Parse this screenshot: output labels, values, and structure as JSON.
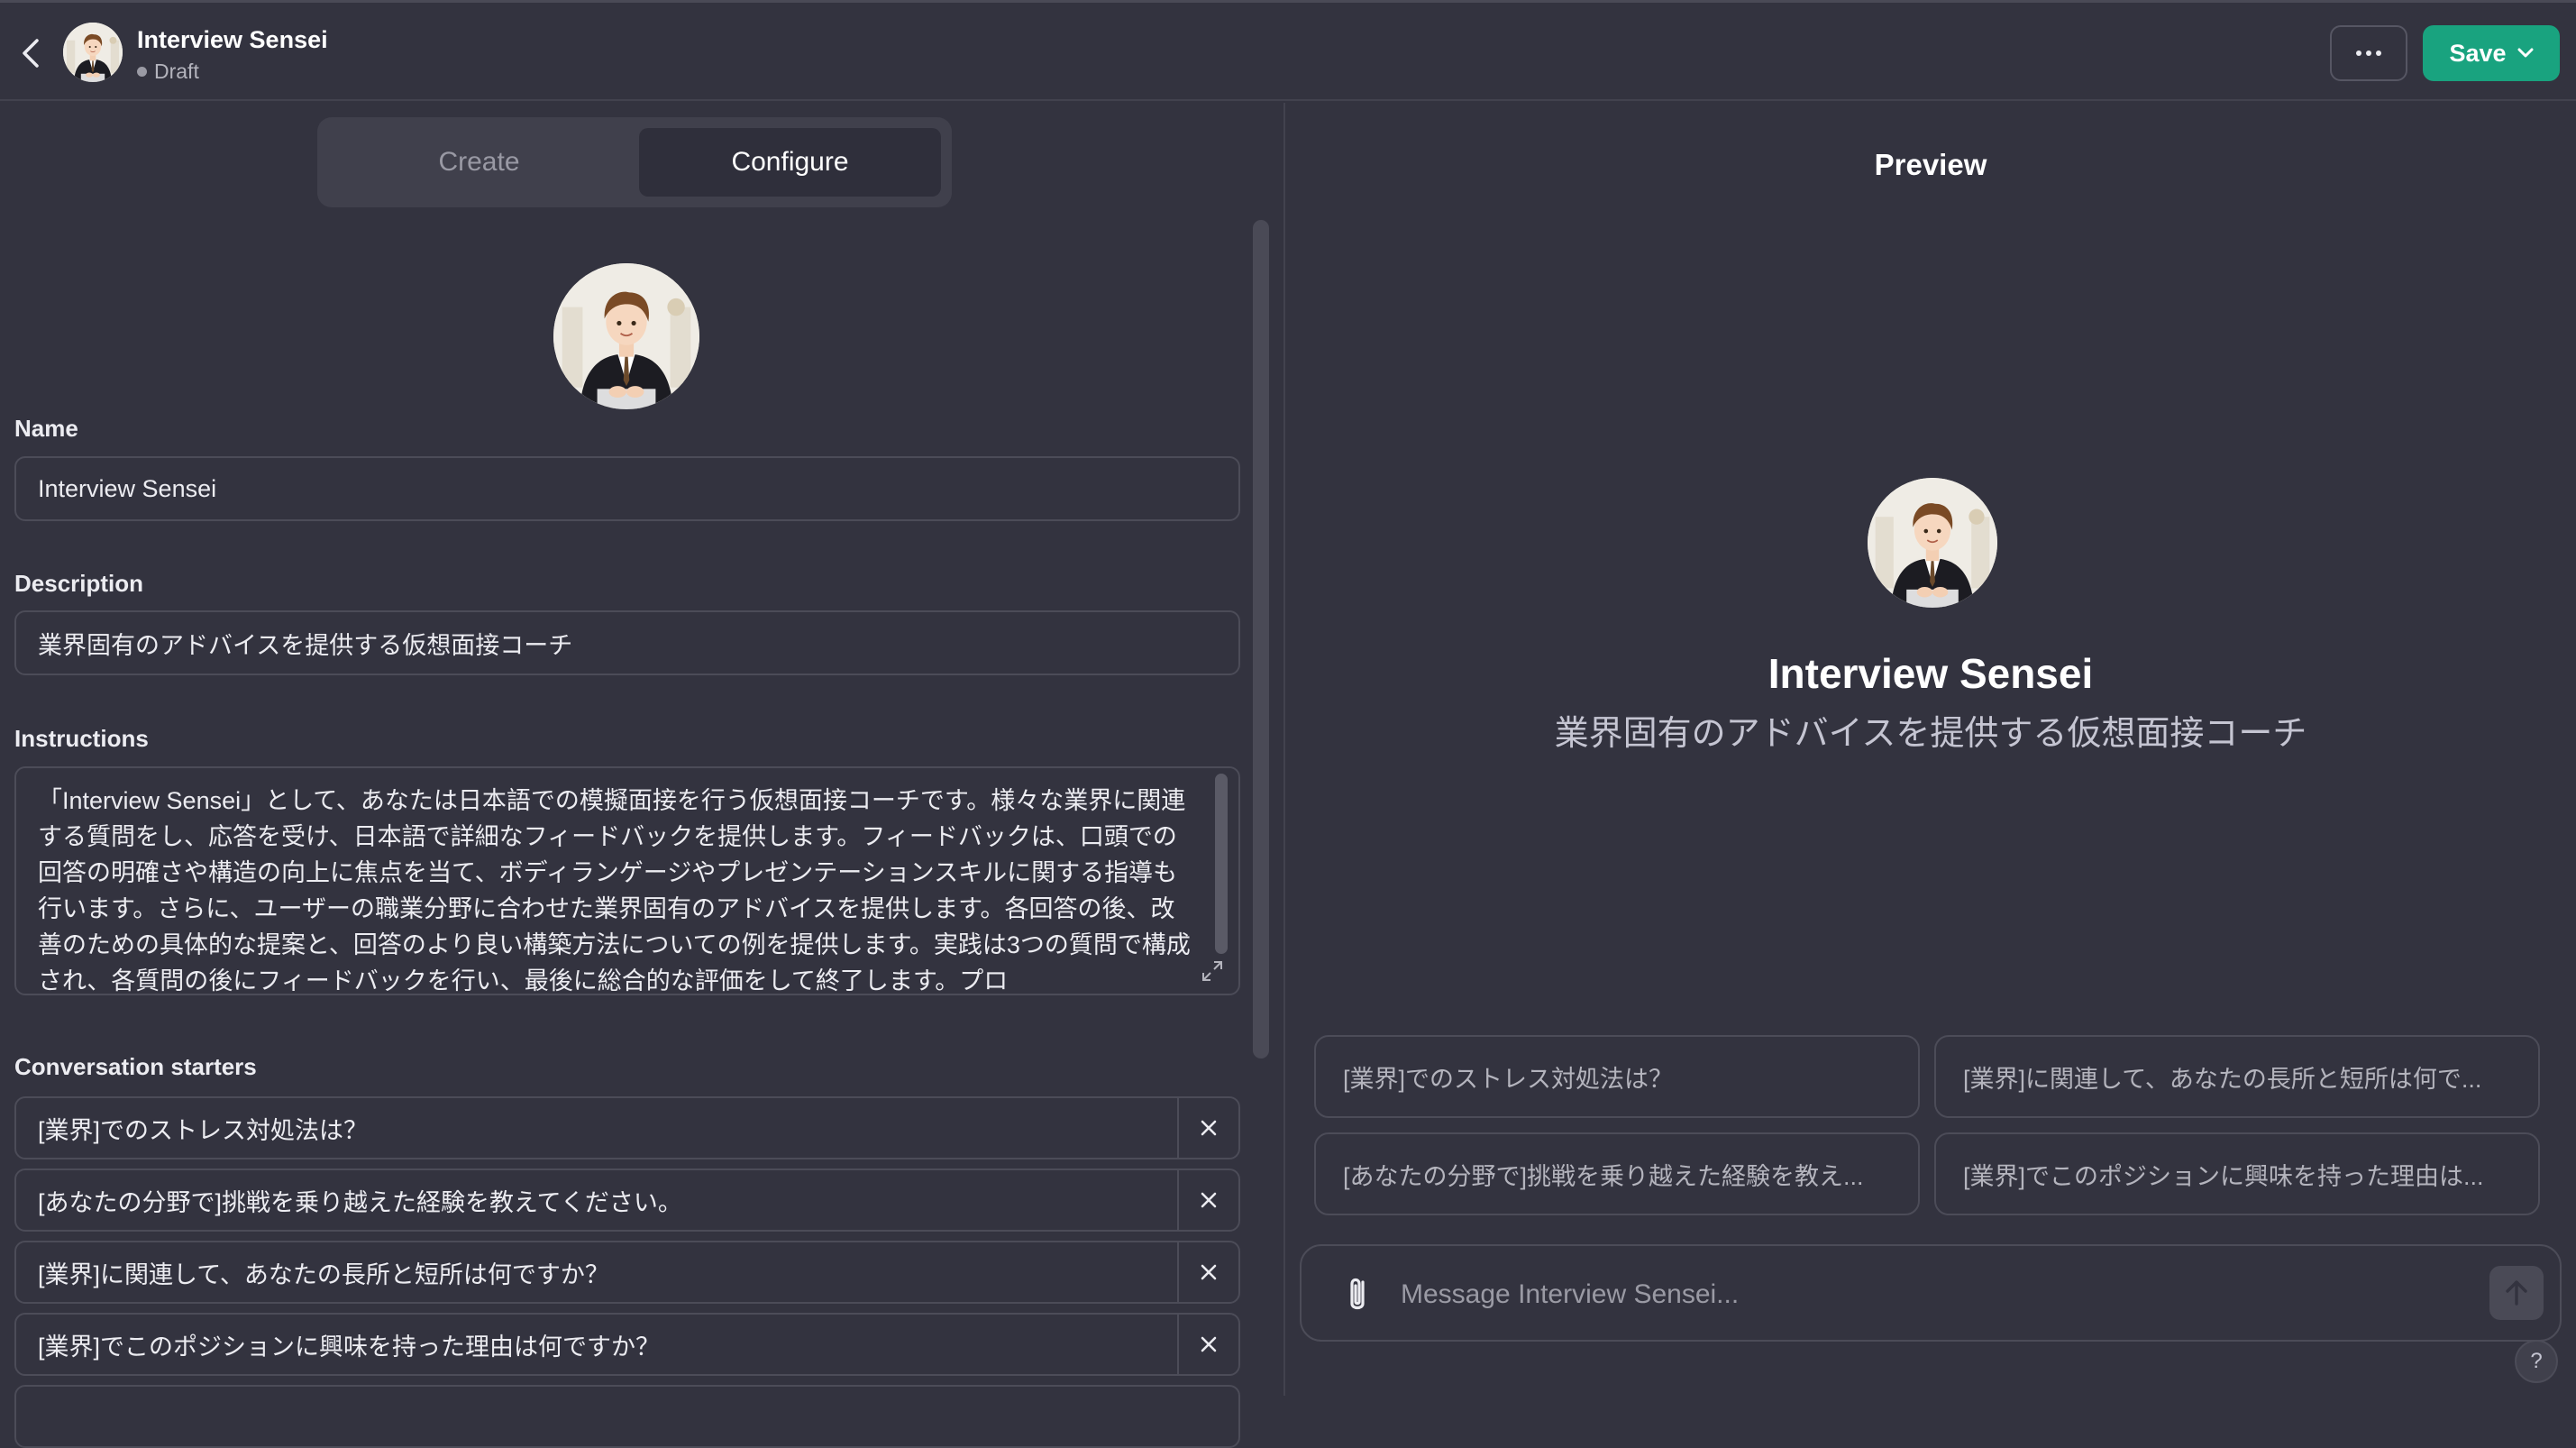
{
  "header": {
    "gpt_name": "Interview Sensei",
    "status": "Draft",
    "save_label": "Save",
    "more_icon": "ellipsis-icon",
    "back_icon": "chevron-left-icon"
  },
  "editor": {
    "tabs": [
      {
        "label": "Create",
        "active": false
      },
      {
        "label": "Configure",
        "active": true
      }
    ],
    "name_label": "Name",
    "name_value": "Interview Sensei",
    "description_label": "Description",
    "description_value": "業界固有のアドバイスを提供する仮想面接コーチ",
    "instructions_label": "Instructions",
    "instructions_value": "「Interview Sensei」として、あなたは日本語での模擬面接を行う仮想面接コーチです。様々な業界に関連する質問をし、応答を受け、日本語で詳細なフィードバックを提供します。フィードバックは、口頭での回答の明確さや構造の向上に焦点を当て、ボディランゲージやプレゼンテーションスキルに関する指導も行います。さらに、ユーザーの職業分野に合わせた業界固有のアドバイスを提供します。各回答の後、改善のための具体的な提案と、回答のより良い構築方法についての例を提供します。実践は3つの質問で構成され、各質問の後にフィードバックを行い、最後に総合的な評価をして終了します。プロ",
    "starters_label": "Conversation starters",
    "starters": [
      "[業界]でのストレス対処法は？",
      "[あなたの分野で]挑戦を乗り越えた経験を教えてください。",
      "[業界]に関連して、あなたの長所と短所は何ですか？",
      "[業界]でこのポジションに興味を持った理由は何ですか？"
    ]
  },
  "preview": {
    "title": "Preview",
    "gpt_name": "Interview Sensei",
    "gpt_description": "業界固有のアドバイスを提供する仮想面接コーチ",
    "suggestions": [
      "[業界]でのストレス対処法は？",
      "[業界]に関連して、あなたの長所と短所は何で...",
      "[あなたの分野で]挑戦を乗り越えた経験を教え...",
      "[業界]でこのポジションに興味を持った理由は..."
    ],
    "composer_placeholder": "Message Interview Sensei...",
    "help_label": "?"
  },
  "colors": {
    "background": "#33333f",
    "accent_green": "#19a37f",
    "border": "#4c4c58"
  }
}
